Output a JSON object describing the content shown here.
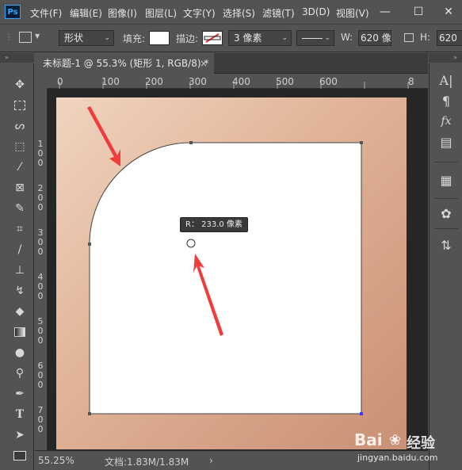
{
  "app": {
    "logo": "Ps"
  },
  "menu": [
    "文件(F)",
    "编辑(E)",
    "图像(I)",
    "图层(L)",
    "文字(Y)",
    "选择(S)",
    "滤镜(T)",
    "3D(D)",
    "视图(V)"
  ],
  "window_controls": {
    "minimize": "—",
    "restore": "☐",
    "close": "✕"
  },
  "options": {
    "mode_select": "形状",
    "fill_label": "填充:",
    "stroke_label": "描边:",
    "stroke_width": "3 像素",
    "width_label": "W:",
    "width_value": "620 像",
    "height_label": "H:",
    "height_value": "620",
    "fill_color": "#ffffff",
    "stroke_color": "#e03030"
  },
  "panel_headers": {
    "left": "»",
    "right": "»"
  },
  "document_tab": {
    "title": "未标题-1 @ 55.3% (矩形 1, RGB/8) *",
    "close": "×"
  },
  "rulers": {
    "top": [
      "0",
      "100",
      "200",
      "300",
      "400",
      "500",
      "600",
      "8"
    ],
    "left": [
      "1\n0\n0",
      "2\n0\n0",
      "3\n0\n0",
      "4\n0\n0",
      "5\n0\n0",
      "6\n0\n0",
      "7\n0\n0",
      "8\n0\n0"
    ]
  },
  "canvas": {
    "radius_tooltip": "R： 233.0 像素",
    "gradient_colors": [
      "#f0d4c0",
      "#e0b296",
      "#c99075"
    ],
    "annotation_arrow_color": "#f03c3c"
  },
  "status": {
    "zoom": "55.25%",
    "doc_info": "文档:1.83M/1.83M",
    "more": "›"
  },
  "tools": [
    "move-tool",
    "marquee-tool",
    "lasso-tool",
    "object-select-tool",
    "eyedropper-tool",
    "crop-tool",
    "frame-tool",
    "healing-brush-tool",
    "brush-tool",
    "clone-stamp-tool",
    "history-brush-tool",
    "eraser-tool",
    "gradient-tool",
    "blur-tool",
    "dodge-tool",
    "pen-tool",
    "type-tool",
    "path-select-tool",
    "rectangle-tool"
  ],
  "right_panel": [
    "character-icon",
    "paragraph-icon",
    "fx-icon",
    "glyphs-icon",
    "table-icon",
    "color-palette-icon",
    "adjust-icon"
  ],
  "watermark": {
    "brand": "Bai",
    "chinese": "经验",
    "url": "jingyan.baidu.com"
  }
}
